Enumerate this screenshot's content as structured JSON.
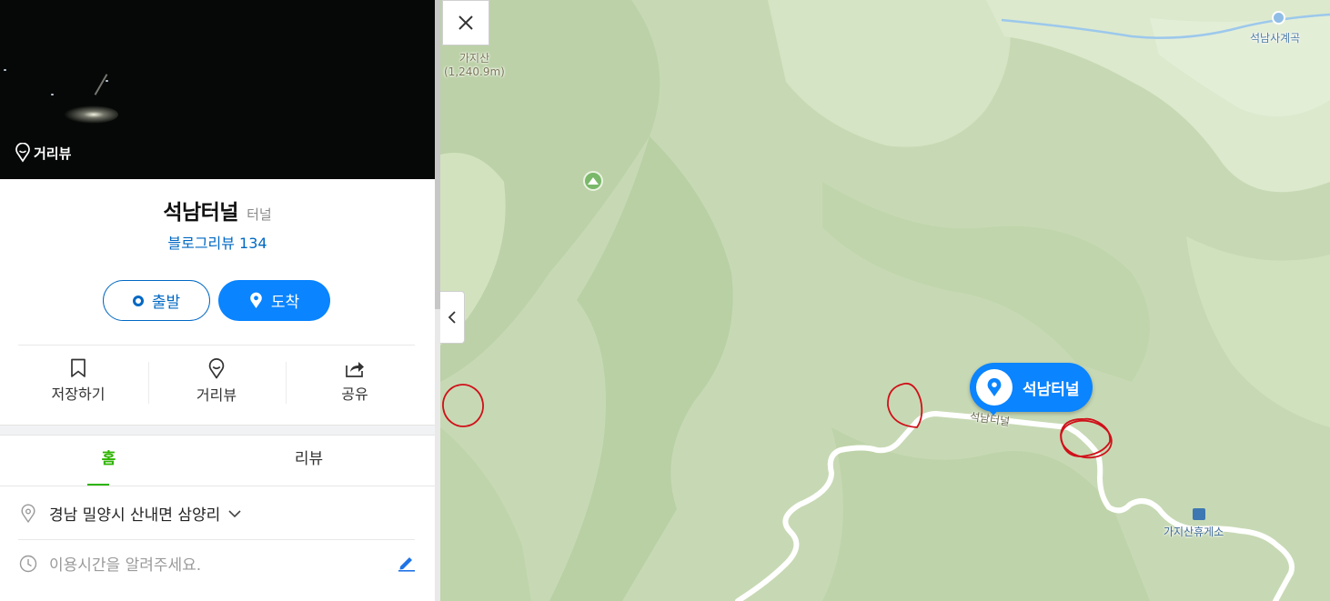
{
  "panel": {
    "streetview_badge": "거리뷰",
    "place_name": "석남터널",
    "category": "터널",
    "blog_review": "블로그리뷰 134",
    "start_button": "출발",
    "arrive_button": "도착",
    "actions": [
      {
        "label": "저장하기",
        "icon": "bookmark-icon"
      },
      {
        "label": "거리뷰",
        "icon": "streetview-pin-icon"
      },
      {
        "label": "공유",
        "icon": "share-icon"
      }
    ],
    "tabs": [
      {
        "label": "홈",
        "active": true
      },
      {
        "label": "리뷰",
        "active": false
      }
    ],
    "address": "경남 밀양시 산내면 삼양리",
    "hours_prompt": "이용시간을 알려주세요."
  },
  "map": {
    "close_icon": "close-icon",
    "collapse_icon": "chevron-left-icon",
    "mountain_name": "가지산",
    "mountain_elevation": "(1,240.9m)",
    "valley_label": "석남사계곡",
    "rest_area_label": "가지산휴게소",
    "road_label": "석남터널",
    "marker_label": "석남터널"
  },
  "colors": {
    "accent_blue": "#0a84ff",
    "link_blue": "#0068c3",
    "tab_green": "#2db400",
    "map_base": "#c7d9b4",
    "annotation_red": "#d0101a"
  }
}
